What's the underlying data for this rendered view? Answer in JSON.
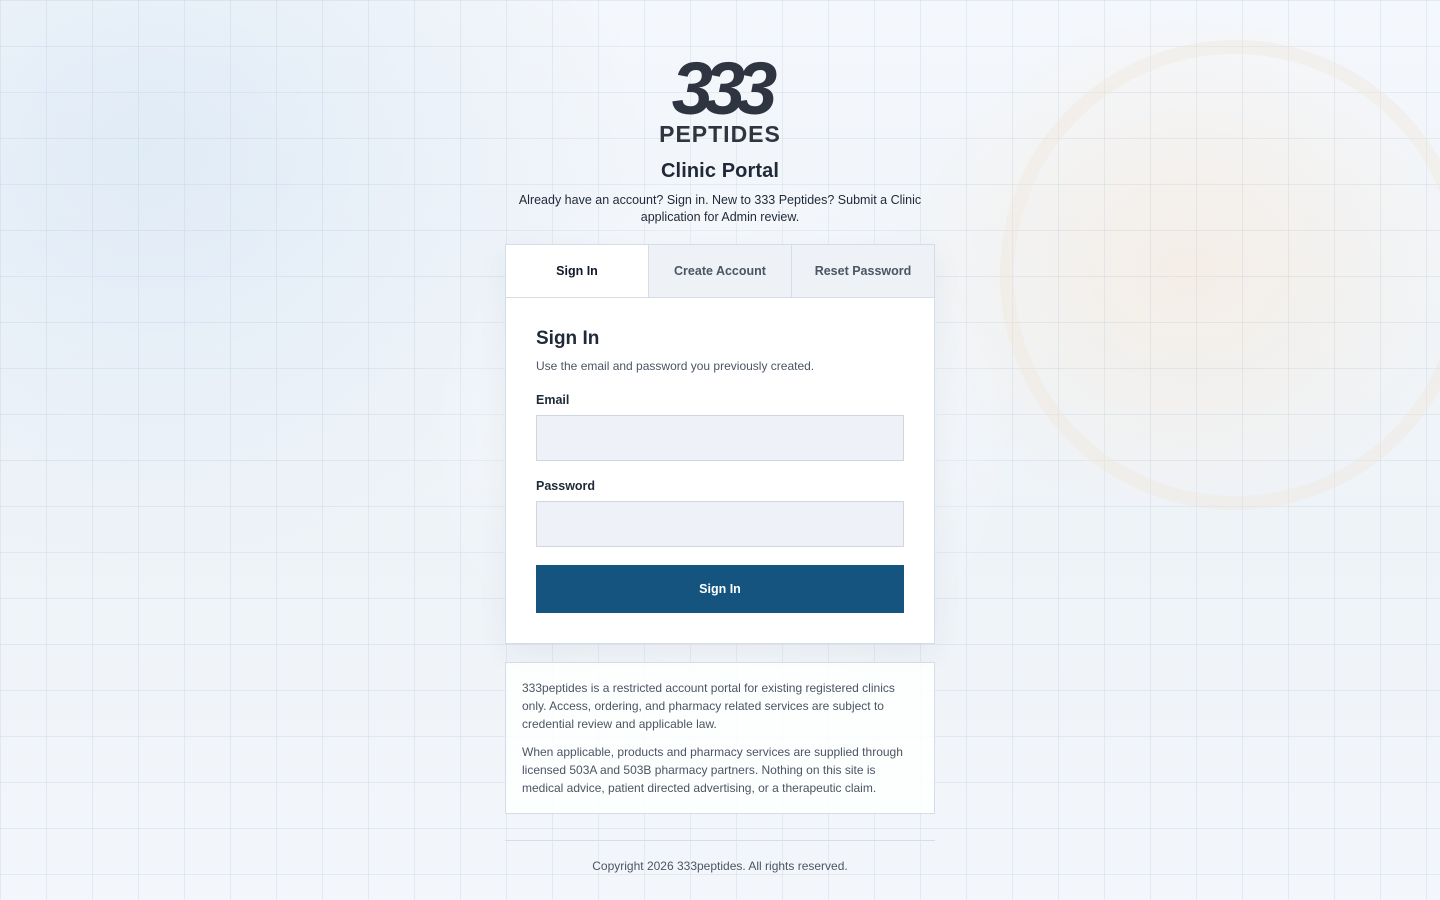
{
  "brand": {
    "logo_number": "333",
    "logo_word": "PEPTIDES",
    "logo_color": "#2e3440"
  },
  "header": {
    "title": "Clinic Portal",
    "intro": "Already have an account? Sign in. New to 333 Peptides? Submit a Clinic application for Admin review."
  },
  "tabs": [
    {
      "label": "Sign In",
      "active": true
    },
    {
      "label": "Create Account",
      "active": false
    },
    {
      "label": "Reset Password",
      "active": false
    }
  ],
  "signin": {
    "title": "Sign In",
    "subtitle": "Use the email and password you previously created.",
    "email_label": "Email",
    "email_value": "",
    "password_label": "Password",
    "password_value": "",
    "submit_label": "Sign In"
  },
  "notice": {
    "paragraph1": "333peptides is a restricted account portal for existing registered clinics only. Access, ordering, and pharmacy related services are subject to credential review and applicable law.",
    "paragraph2": "When applicable, products and pharmacy services are supplied through licensed 503A and 503B pharmacy partners. Nothing on this site is medical advice, patient directed advertising, or a therapeutic claim."
  },
  "footer": {
    "copyright": "Copyright 2026 333peptides. All rights reserved."
  },
  "colors": {
    "accent": "#15547e",
    "background": "#eef3f8",
    "input_bg": "#eef2f8"
  }
}
